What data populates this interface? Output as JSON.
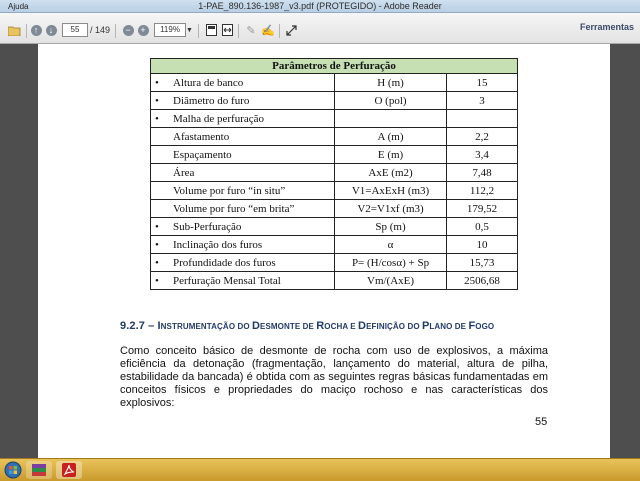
{
  "window": {
    "title": "1-PAE_890.136-1987_v3.pdf (PROTEGIDO) - Adobe Reader",
    "menu": "Ajuda"
  },
  "toolbar": {
    "page_current": "55",
    "page_total": "/ 149",
    "zoom": "119%",
    "tools_label": "Ferramentas"
  },
  "table": {
    "title": "Parâmetros de Perfuração",
    "rows": [
      {
        "bullet": "•",
        "param": "Altura de banco",
        "formula": "H (m)",
        "value": "15"
      },
      {
        "bullet": "•",
        "param": "Diâmetro do furo",
        "formula": "O (pol)",
        "value": "3"
      },
      {
        "bullet": "•",
        "param": "Malha de perfuração",
        "formula": "",
        "value": ""
      },
      {
        "bullet": "",
        "param": "Afastamento",
        "formula": "A (m)",
        "value": "2,2"
      },
      {
        "bullet": "",
        "param": "Espaçamento",
        "formula": "E (m)",
        "value": "3,4"
      },
      {
        "bullet": "",
        "param": "Área",
        "formula": "AxE (m2)",
        "value": "7,48"
      },
      {
        "bullet": "",
        "param": "Volume por furo “in situ”",
        "formula": "V1=AxExH (m3)",
        "value": "112,2"
      },
      {
        "bullet": "",
        "param": "Volume por furo “em brita”",
        "formula": "V2=V1xf (m3)",
        "value": "179,52"
      },
      {
        "bullet": "•",
        "param": "Sub-Perfuração",
        "formula": "Sp (m)",
        "value": "0,5"
      },
      {
        "bullet": "•",
        "param": "Inclinação dos furos",
        "formula": "α",
        "value": "10"
      },
      {
        "bullet": "•",
        "param": "Profundidade dos furos",
        "formula": "P= (H/cosα) + Sp",
        "value": "15,73"
      },
      {
        "bullet": "•",
        "param": "Perfuração Mensal Total",
        "formula": "Vm/(AxE)",
        "value": "2506,68"
      }
    ]
  },
  "section": {
    "number": "9.2.7 – I",
    "heading_parts": [
      "NSTRUMENTAÇÃO DO ",
      "D",
      "ESMONTE DE ",
      "R",
      "OCHA E ",
      "D",
      "EFINIÇÃO DO ",
      "P",
      "LANO DE ",
      "F",
      "OGO"
    ],
    "paragraph": "Como conceito básico de desmonte de rocha com uso de explosivos, a máxima eficiência da detonação (fragmentação, lançamento do material, altura de pilha, estabilidade da bancada) é obtida com as seguintes regras básicas fundamentadas em conceitos físicos e propriedades do maciço rochoso e nas características dos explosivos:",
    "page_number": "55"
  },
  "taskbar": {
    "icons": [
      "start-orb-icon",
      "winrar-icon",
      "acrobat-icon"
    ]
  }
}
